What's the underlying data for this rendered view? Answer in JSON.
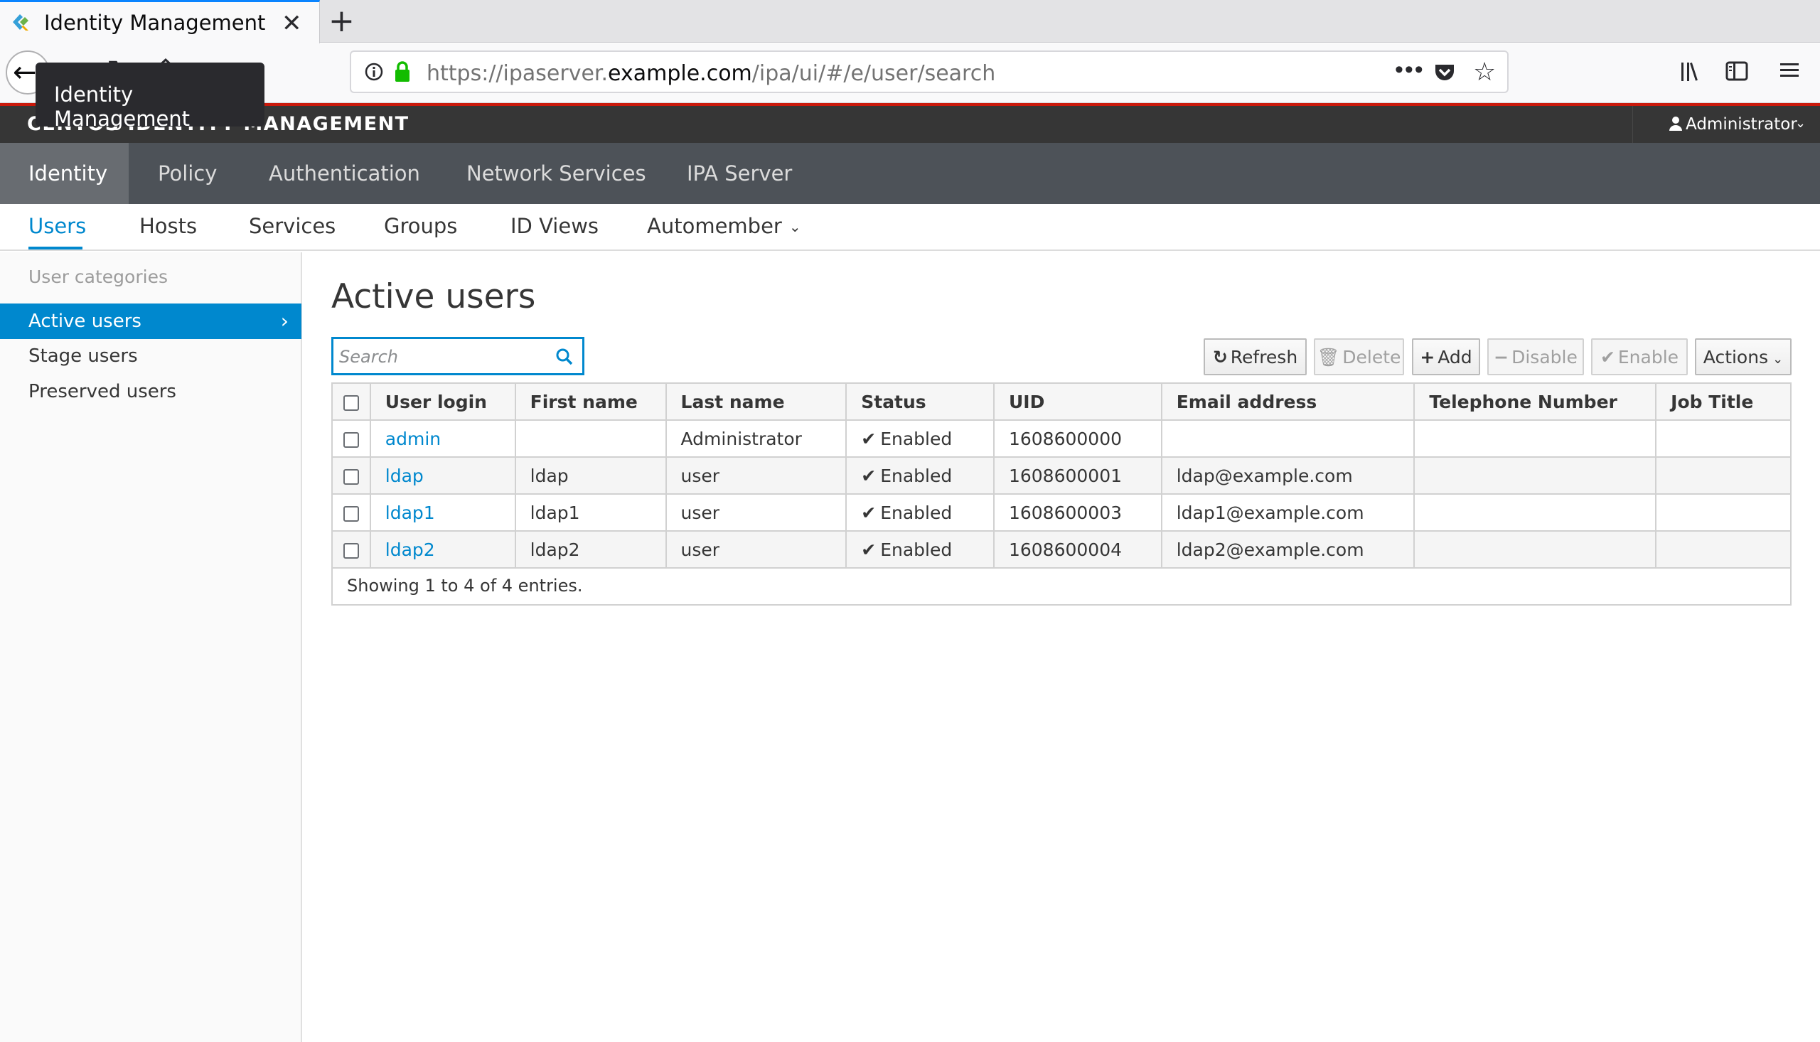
{
  "browser": {
    "tab_title": "Identity Management",
    "tab_close": "✕",
    "new_tab": "+",
    "tooltip": "Identity Management",
    "url_prefix": "https://ipaserver.",
    "url_domain": "example.com",
    "url_path": "/ipa/ui/#/e/user/search",
    "url_more": "•••"
  },
  "app": {
    "brand": "CENTOS IDENTITY MANAGEMENT",
    "user": "Administrator"
  },
  "main_nav": [
    "Identity",
    "Policy",
    "Authentication",
    "Network Services",
    "IPA Server"
  ],
  "sub_nav": [
    "Users",
    "Hosts",
    "Services",
    "Groups",
    "ID Views",
    "Automember"
  ],
  "sidebar": {
    "header": "User categories",
    "items": [
      "Active users",
      "Stage users",
      "Preserved users"
    ]
  },
  "page_title": "Active users",
  "search": {
    "placeholder": "Search"
  },
  "buttons": {
    "refresh": "Refresh",
    "delete": "Delete",
    "add": "Add",
    "disable": "Disable",
    "enable": "Enable",
    "actions": "Actions"
  },
  "table": {
    "headers": [
      "User login",
      "First name",
      "Last name",
      "Status",
      "UID",
      "Email address",
      "Telephone Number",
      "Job Title"
    ],
    "rows": [
      {
        "login": "admin",
        "first": "",
        "last": "Administrator",
        "status": "Enabled",
        "uid": "1608600000",
        "email": "",
        "phone": "",
        "job": ""
      },
      {
        "login": "ldap",
        "first": "ldap",
        "last": "user",
        "status": "Enabled",
        "uid": "1608600001",
        "email": "ldap@example.com",
        "phone": "",
        "job": ""
      },
      {
        "login": "ldap1",
        "first": "ldap1",
        "last": "user",
        "status": "Enabled",
        "uid": "1608600003",
        "email": "ldap1@example.com",
        "phone": "",
        "job": ""
      },
      {
        "login": "ldap2",
        "first": "ldap2",
        "last": "user",
        "status": "Enabled",
        "uid": "1608600004",
        "email": "ldap2@example.com",
        "phone": "",
        "job": ""
      }
    ],
    "footer": "Showing 1 to 4 of 4 entries."
  },
  "colors": {
    "accent": "#0088ce",
    "nav_bg": "#4d5258",
    "brand_bg": "#363636",
    "red_line": "#c9190b"
  },
  "icons": {
    "back": "back-arrow-icon",
    "forward": "forward-arrow-icon",
    "reload": "reload-icon",
    "home": "home-icon",
    "info": "info-icon",
    "lock": "lock-icon",
    "pocket": "pocket-icon",
    "star": "bookmark-star-icon",
    "library": "library-icon",
    "sidebar": "sidebar-icon",
    "menu": "hamburger-menu-icon",
    "search": "search-icon",
    "user": "user-icon",
    "check": "check-icon"
  }
}
